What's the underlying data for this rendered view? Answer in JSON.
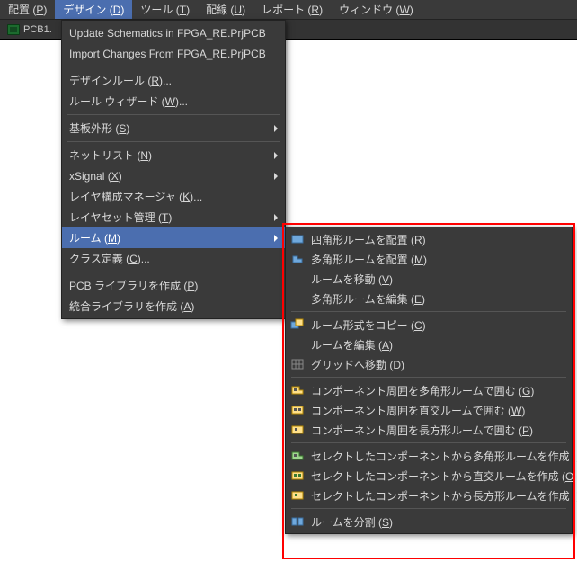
{
  "menubar": {
    "place": "配置 (P)",
    "design": "デザイン (D)",
    "tools": "ツール (T)",
    "route": "配線 (U)",
    "report": "レポート (R)",
    "window": "ウィンドウ (W)"
  },
  "tab": {
    "label": "PCB1."
  },
  "menu": {
    "update_schematics": "Update Schematics in FPGA_RE.PrjPCB",
    "import_changes": "Import Changes From FPGA_RE.PrjPCB",
    "design_rules": "デザインルール (R)...",
    "rule_wizard": "ルール ウィザード (W)...",
    "board_shape": "基板外形 (S)",
    "netlist": "ネットリスト (N)",
    "xsignal": "xSignal (X)",
    "layer_stack": "レイヤ構成マネージャ (K)...",
    "layerset": "レイヤセット管理 (T)",
    "rooms": "ルーム (M)",
    "class_def": "クラス定義 (C)...",
    "make_pcb_lib": "PCB ライブラリを作成 (P)",
    "make_int_lib": "統合ライブラリを作成 (A)"
  },
  "submenu": {
    "place_rect": "四角形ルームを配置 (R)",
    "place_poly": "多角形ルームを配置 (M)",
    "move_room": "ルームを移動 (V)",
    "edit_poly": "多角形ルームを編集 (E)",
    "copy_room_fmt": "ルーム形式をコピー (C)",
    "edit_room": "ルームを編集 (A)",
    "move_to_grid": "グリッドへ移動 (D)",
    "wrap_poly": "コンポーネント周囲を多角形ルームで囲む (G)",
    "wrap_ortho": "コンポーネント周囲を直交ルームで囲む (W)",
    "wrap_rect": "コンポーネント周囲を長方形ルームで囲む (P)",
    "create_poly": "セレクトしたコンポーネントから多角形ルームを作成 (N)",
    "create_ortho": "セレクトしたコンポーネントから直交ルームを作成 (O)",
    "create_rect": "セレクトしたコンポーネントから長方形ルームを作成 (T)",
    "slice_room": "ルームを分割 (S)"
  }
}
